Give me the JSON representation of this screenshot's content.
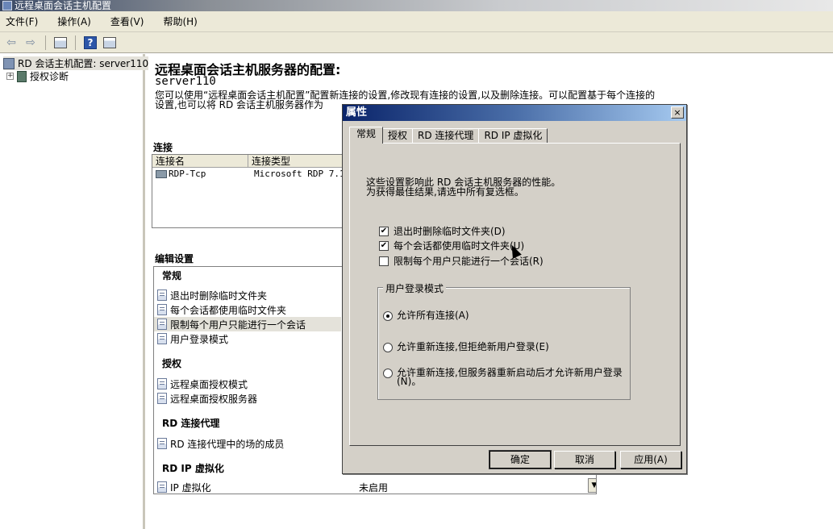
{
  "window": {
    "title": "远程桌面会话主机配置"
  },
  "menu": [
    "文件(F)",
    "操作(A)",
    "查看(V)",
    "帮助(H)"
  ],
  "tree": {
    "root": "RD 会话主机配置: server110",
    "child": "授权诊断"
  },
  "main": {
    "title": "远程桌面会话主机服务器的配置:",
    "server": "server110",
    "description": "您可以使用“远程桌面会话主机配置”配置新连接的设置,修改现有连接的设置,以及删除连接。可以配置基于每个连接的设置,也可以将 RD 会话主机服务器作为",
    "connections_label": "连接",
    "connections_columns": [
      "连接名",
      "连接类型"
    ],
    "connections": [
      {
        "name": "RDP-Tcp",
        "type": "Microsoft RDP 7.1"
      }
    ],
    "edit_label": "编辑设置",
    "groups": {
      "general": "常规",
      "licensing": "授权",
      "broker": "RD 连接代理",
      "ipvirt": "RD IP 虚拟化"
    },
    "items": {
      "g1": "退出时删除临时文件夹",
      "g2": "每个会话都使用临时文件夹",
      "g3": "限制每个用户只能进行一个会话",
      "g4": "用户登录模式",
      "l1": "远程桌面授权模式",
      "l2": "远程桌面授权服务器",
      "b1": "RD 连接代理中的场的成员",
      "i1": "IP 虚拟化",
      "i1_value": "未启用"
    }
  },
  "dialog": {
    "title": "属性",
    "close": "×",
    "tabs": [
      "常规",
      "授权",
      "RD 连接代理",
      "RD IP 虚拟化"
    ],
    "desc_line1": "这些设置影响此 RD 会话主机服务器的性能。",
    "desc_line2": "为获得最佳结果,请选中所有复选框。",
    "checkboxes": [
      {
        "label": "退出时删除临时文件夹(D)",
        "checked": true
      },
      {
        "label": "每个会话都使用临时文件夹(U)",
        "checked": true
      },
      {
        "label": "限制每个用户只能进行一个会话(R)",
        "checked": false
      }
    ],
    "group_label": "用户登录模式",
    "radios": [
      {
        "label": "允许所有连接(A)",
        "selected": true
      },
      {
        "label": "允许重新连接,但拒绝新用户登录(E)",
        "selected": false
      },
      {
        "label": "允许重新连接,但服务器重新启动后才允许新用户登录(N)。",
        "selected": false
      }
    ],
    "buttons": {
      "ok": "确定",
      "cancel": "取消",
      "apply": "应用(A)"
    }
  }
}
